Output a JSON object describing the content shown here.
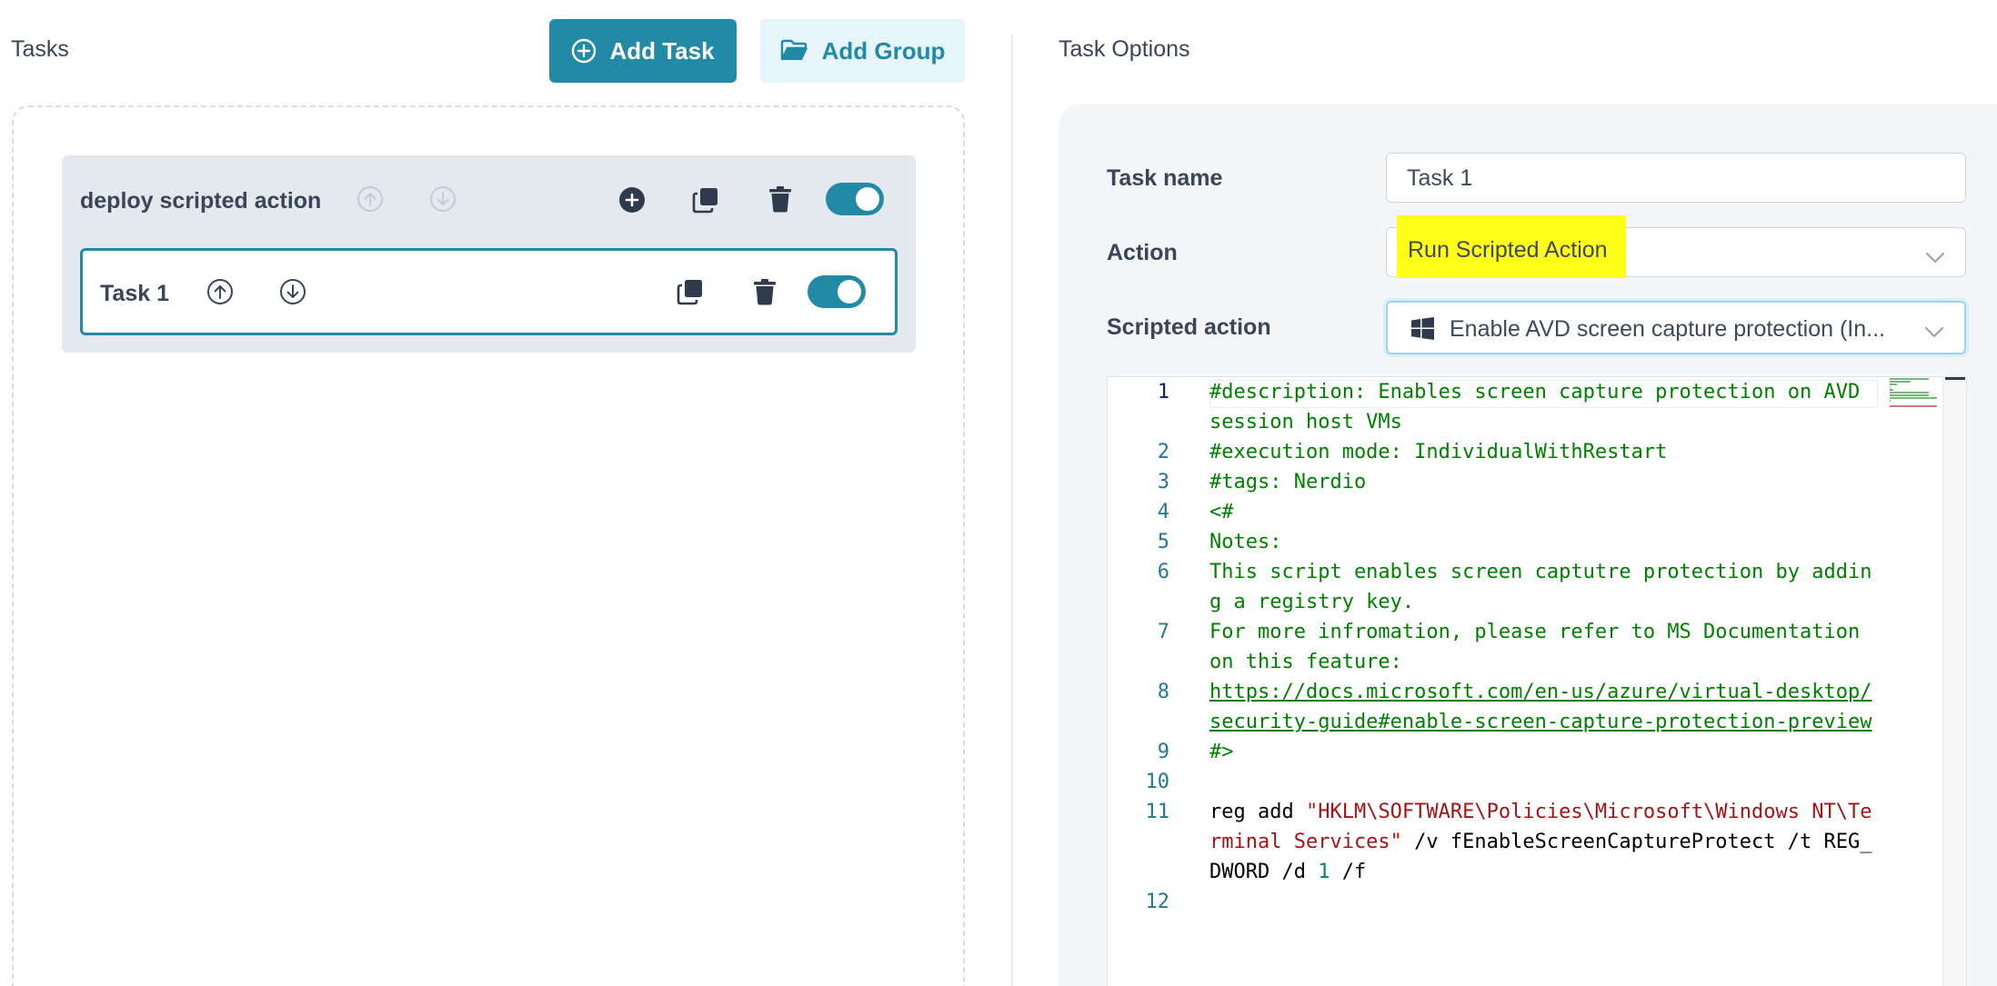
{
  "tasks_panel": {
    "title": "Tasks",
    "add_task_label": "Add Task",
    "add_group_label": "Add Group"
  },
  "group": {
    "name": "deploy scripted action",
    "enabled": true,
    "tasks": [
      {
        "name": "Task 1",
        "enabled": true,
        "selected": true
      }
    ]
  },
  "options_panel": {
    "title": "Task Options",
    "task_name_label": "Task name",
    "task_name_value": "Task 1",
    "action_label": "Action",
    "action_value": "Run Scripted Action",
    "scripted_action_label": "Scripted action",
    "scripted_action_value": "Enable AVD screen capture protection (In..."
  },
  "editor": {
    "current_line": 1,
    "lines": [
      {
        "n": 1,
        "tokens": [
          {
            "t": "comment",
            "v": "#description: Enables screen capture protection on AVD session host VMs"
          }
        ]
      },
      {
        "n": 2,
        "tokens": [
          {
            "t": "comment",
            "v": "#execution mode: IndividualWithRestart"
          }
        ]
      },
      {
        "n": 3,
        "tokens": [
          {
            "t": "comment",
            "v": "#tags: Nerdio"
          }
        ]
      },
      {
        "n": 4,
        "tokens": [
          {
            "t": "comment",
            "v": "<#"
          }
        ]
      },
      {
        "n": 5,
        "tokens": [
          {
            "t": "comment",
            "v": "Notes:"
          }
        ]
      },
      {
        "n": 6,
        "tokens": [
          {
            "t": "comment",
            "v": "This script enables screen captutre protection by adding a registry key."
          }
        ]
      },
      {
        "n": 7,
        "tokens": [
          {
            "t": "comment",
            "v": "For more infromation, please refer to MS Documentation on this feature:"
          }
        ]
      },
      {
        "n": 8,
        "tokens": [
          {
            "t": "link",
            "v": "https://docs.microsoft.com/en-us/azure/virtual-desktop/security-guide#enable-screen-capture-protection-preview"
          }
        ]
      },
      {
        "n": 9,
        "tokens": [
          {
            "t": "comment",
            "v": "#>"
          }
        ]
      },
      {
        "n": 10,
        "tokens": []
      },
      {
        "n": 11,
        "tokens": [
          {
            "t": "plain",
            "v": "reg add "
          },
          {
            "t": "string",
            "v": "\"HKLM\\SOFTWARE\\Policies\\Microsoft\\Windows NT\\Terminal Services\""
          },
          {
            "t": "plain",
            "v": " /v fEnableScreenCaptureProtect /t REG_DWORD /d "
          },
          {
            "t": "number",
            "v": "1"
          },
          {
            "t": "plain",
            "v": " /f"
          }
        ]
      },
      {
        "n": 12,
        "tokens": []
      }
    ]
  },
  "colors": {
    "accent": "#228aa4",
    "highlight": "#ffff17",
    "comment": "#008000",
    "string": "#a31515",
    "number": "#098658",
    "line_number": "#237893"
  },
  "icons": {
    "add_task": "plus-circle-icon",
    "add_group": "folder-open-icon",
    "move_up": "arrow-up-circle-icon",
    "move_down": "arrow-down-circle-icon",
    "add": "plus-circle-filled-icon",
    "copy": "copy-icon",
    "delete": "trash-icon",
    "windows": "windows-icon",
    "dropdown": "chevron-down-icon"
  }
}
